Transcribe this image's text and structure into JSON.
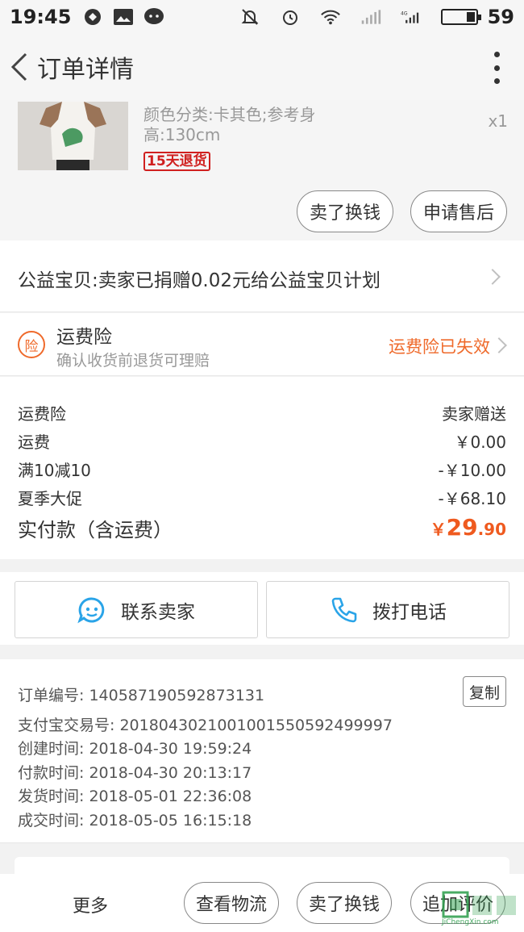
{
  "status_bar": {
    "time": "19:45",
    "battery": "59"
  },
  "nav": {
    "title": "订单详情"
  },
  "product": {
    "sku": "颜色分类:卡其色;参考身高:130cm",
    "qty": "x1",
    "tag": "15天退货",
    "buttons": [
      "卖了换钱",
      "申请售后"
    ]
  },
  "charity": {
    "text": "公益宝贝:卖家已捐赠0.02元给公益宝贝计划"
  },
  "insurance": {
    "badge": "险",
    "title": "运费险",
    "subtitle": "确认收货前退货可理赔",
    "status": "运费险已失效"
  },
  "fees": {
    "rows": [
      {
        "label": "运费险",
        "value": "卖家赠送"
      },
      {
        "label": "运费",
        "value": "￥0.00"
      },
      {
        "label": "满10减10",
        "value": "-￥10.00"
      },
      {
        "label": "夏季大促",
        "value": "-￥68.10"
      }
    ],
    "total_label": "实付款（含运费）",
    "total_symbol": "￥",
    "total_int": "29",
    "total_dec": ".90"
  },
  "actions": {
    "contact_seller": "联系卖家",
    "call_phone": "拨打电话"
  },
  "order_info": {
    "copy": "复制",
    "lines": [
      "订单编号: 140587190592873131",
      "支付宝交易号: 2018043021001001550592499997",
      "创建时间: 2018-04-30 19:59:24",
      "付款时间: 2018-04-30 20:13:17",
      "发货时间: 2018-05-01 22:36:08",
      "成交时间: 2018-05-05 16:15:18"
    ]
  },
  "bottom_bar": {
    "more": "更多",
    "buttons": [
      "查看物流",
      "卖了换钱",
      "追加评价"
    ]
  },
  "watermark": "JiChengXin.com",
  "colors": {
    "accent": "#ef5a1f",
    "tag_red": "#d0201f",
    "icon_blue": "#2aa4e8"
  }
}
